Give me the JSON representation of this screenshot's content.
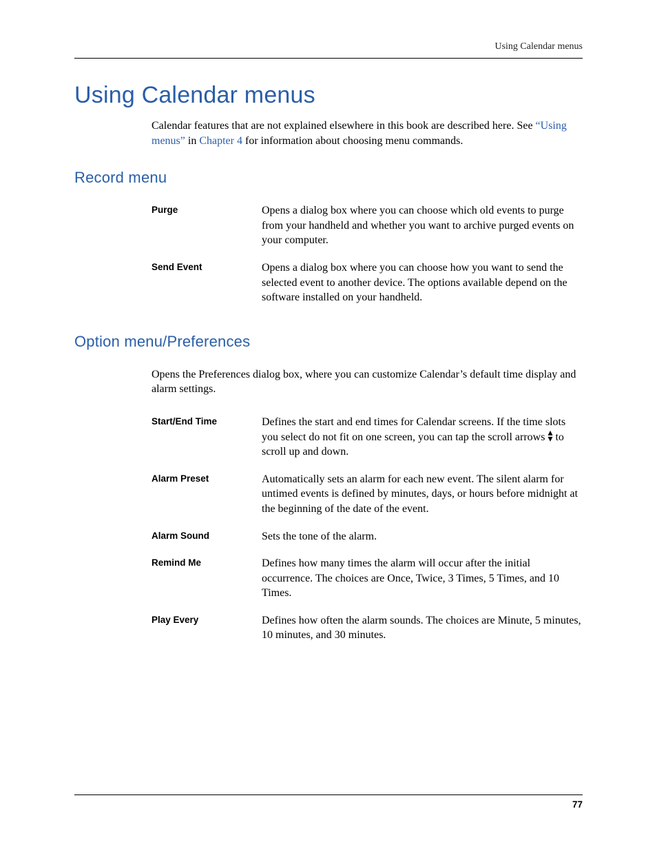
{
  "header": {
    "running": "Using Calendar menus"
  },
  "title": "Using Calendar menus",
  "intro": {
    "pre": "Calendar features that are not explained elsewhere in this book are described here. See ",
    "link1": "“Using menus”",
    "mid": " in ",
    "link2": "Chapter 4",
    "post": " for information about choosing menu commands."
  },
  "record": {
    "heading": "Record menu",
    "items": [
      {
        "term": "Purge",
        "desc": "Opens a dialog box where you can choose which old events to purge from your handheld and whether you want to archive purged events on your computer."
      },
      {
        "term": "Send Event",
        "desc": "Opens a dialog box where you can choose how you want to send the selected event to another device. The options available depend on the software installed on your handheld."
      }
    ]
  },
  "options": {
    "heading": "Option menu/Preferences",
    "intro": "Opens the Preferences dialog box, where you can customize Calendar’s default time display and alarm settings.",
    "items": [
      {
        "term": "Start/End Time",
        "desc_pre": "Defines the start and end times for Calendar screens. If the time slots you select do not fit on one screen, you can tap the scroll arrows ",
        "desc_post": " to scroll up and down."
      },
      {
        "term": "Alarm Preset",
        "desc": "Automatically sets an alarm for each new event. The silent alarm for untimed events is defined by minutes, days, or hours before midnight at the beginning of the date of the event."
      },
      {
        "term": "Alarm Sound",
        "desc": "Sets the tone of the alarm."
      },
      {
        "term": "Remind Me",
        "desc": "Defines how many times the alarm will occur after the initial occurrence. The choices are Once, Twice, 3 Times, 5 Times, and 10 Times."
      },
      {
        "term": "Play Every",
        "desc": "Defines how often the alarm sounds. The choices are Minute, 5 minutes, 10 minutes, and 30 minutes."
      }
    ]
  },
  "page_number": "77"
}
